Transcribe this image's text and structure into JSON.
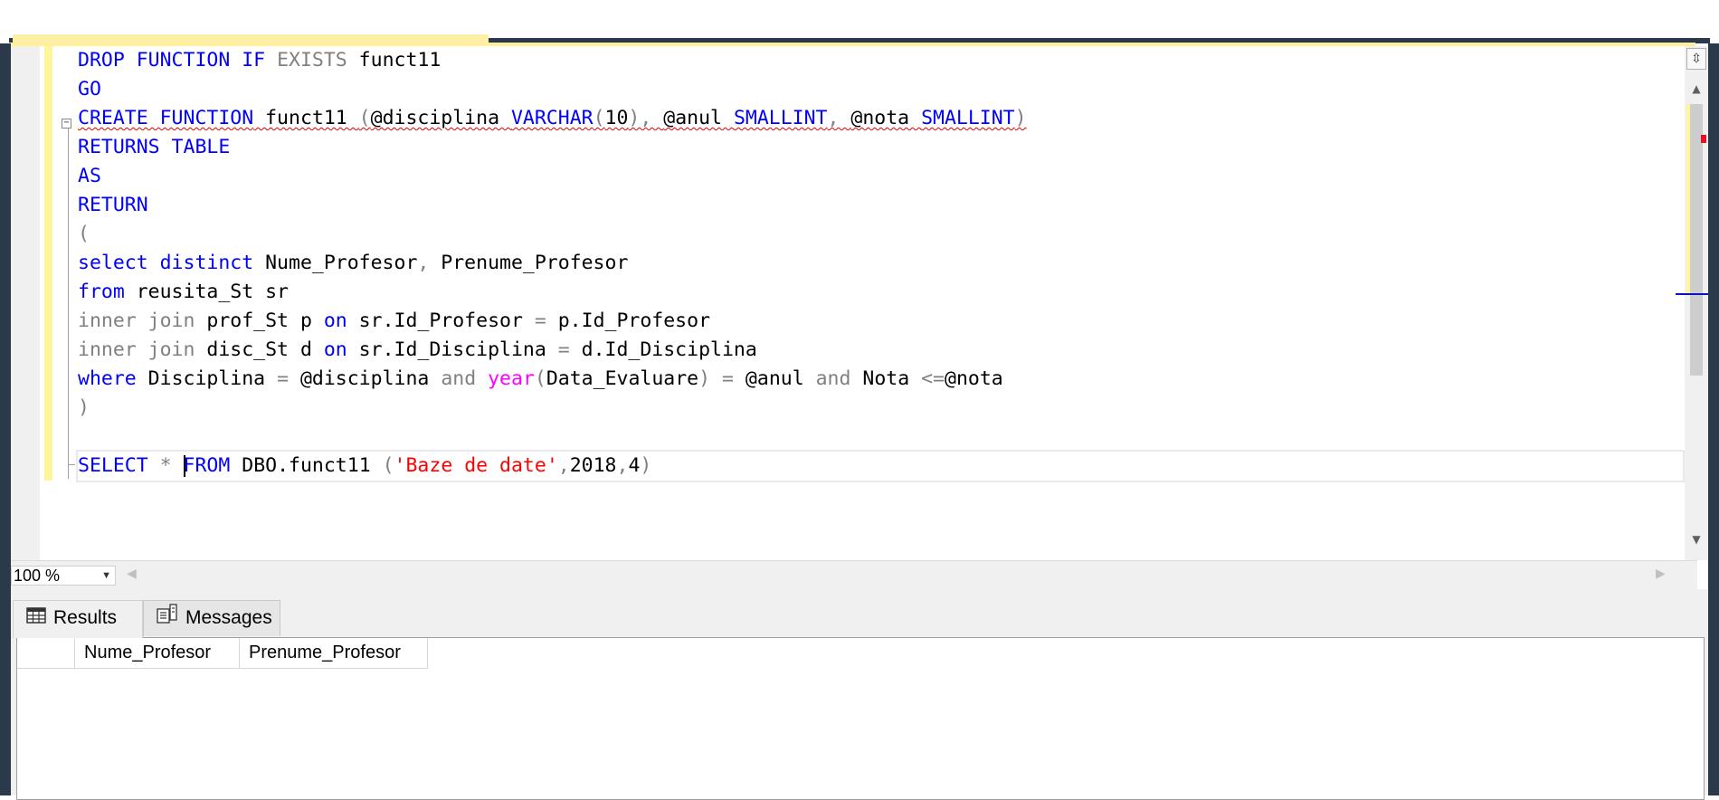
{
  "editor": {
    "lines": [
      [
        {
          "t": "DROP FUNCTION IF ",
          "c": "kw"
        },
        {
          "t": "EXISTS",
          "c": "gr"
        },
        {
          "t": " funct11",
          "c": ""
        }
      ],
      [
        {
          "t": "GO",
          "c": "kw"
        }
      ],
      [
        {
          "t": "CREATE FUNCTION",
          "c": "kw sq"
        },
        {
          "t": " funct11 ",
          "c": "sq"
        },
        {
          "t": "(",
          "c": "gr sq"
        },
        {
          "t": "@disciplina ",
          "c": "sq"
        },
        {
          "t": "VARCHAR",
          "c": "kw sq"
        },
        {
          "t": "(",
          "c": "gr sq"
        },
        {
          "t": "10",
          "c": "sq"
        },
        {
          "t": "), ",
          "c": "gr sq"
        },
        {
          "t": "@anul ",
          "c": "sq"
        },
        {
          "t": "SMALLINT",
          "c": "kw sq"
        },
        {
          "t": ", ",
          "c": "gr sq"
        },
        {
          "t": "@nota ",
          "c": "sq"
        },
        {
          "t": "SMALLINT",
          "c": "kw sq"
        },
        {
          "t": ")",
          "c": "gr sq"
        }
      ],
      [
        {
          "t": "RETURNS TABLE",
          "c": "kw"
        }
      ],
      [
        {
          "t": "AS",
          "c": "kw"
        }
      ],
      [
        {
          "t": "RETURN",
          "c": "kw"
        }
      ],
      [
        {
          "t": "(",
          "c": "gr"
        }
      ],
      [
        {
          "t": "select distinct",
          "c": "kw"
        },
        {
          "t": " Nume_Profesor",
          "c": ""
        },
        {
          "t": ",",
          "c": "gr"
        },
        {
          "t": " Prenume_Profesor",
          "c": ""
        }
      ],
      [
        {
          "t": "from",
          "c": "kw"
        },
        {
          "t": " reusita_St sr",
          "c": ""
        }
      ],
      [
        {
          "t": "inner join",
          "c": "gr"
        },
        {
          "t": " prof_St p ",
          "c": ""
        },
        {
          "t": "on",
          "c": "kw"
        },
        {
          "t": " sr.Id_Profesor ",
          "c": ""
        },
        {
          "t": "=",
          "c": "gr"
        },
        {
          "t": " p.Id_Profesor",
          "c": ""
        }
      ],
      [
        {
          "t": "inner join",
          "c": "gr"
        },
        {
          "t": " disc_St d ",
          "c": ""
        },
        {
          "t": "on",
          "c": "kw"
        },
        {
          "t": " sr.Id_Disciplina ",
          "c": ""
        },
        {
          "t": "=",
          "c": "gr"
        },
        {
          "t": " d.Id_Disciplina",
          "c": ""
        }
      ],
      [
        {
          "t": "where",
          "c": "kw"
        },
        {
          "t": " Disciplina ",
          "c": ""
        },
        {
          "t": "=",
          "c": "gr"
        },
        {
          "t": " @disciplina ",
          "c": ""
        },
        {
          "t": "and",
          "c": "gr"
        },
        {
          "t": " ",
          "c": ""
        },
        {
          "t": "year",
          "c": "fn"
        },
        {
          "t": "(",
          "c": "gr"
        },
        {
          "t": "Data_Evaluare",
          "c": ""
        },
        {
          "t": ")",
          "c": "gr"
        },
        {
          "t": " ",
          "c": ""
        },
        {
          "t": "=",
          "c": "gr"
        },
        {
          "t": " @anul ",
          "c": ""
        },
        {
          "t": "and",
          "c": "gr"
        },
        {
          "t": " Nota ",
          "c": ""
        },
        {
          "t": "<=",
          "c": "gr"
        },
        {
          "t": "@nota",
          "c": ""
        }
      ],
      [
        {
          "t": ")",
          "c": "gr"
        }
      ],
      [],
      [
        {
          "t": "SELECT",
          "c": "kw"
        },
        {
          "t": " ",
          "c": ""
        },
        {
          "t": "*",
          "c": "gr"
        },
        {
          "t": " ",
          "c": ""
        },
        {
          "t": "|",
          "c": "caret"
        },
        {
          "t": "FROM",
          "c": "kw"
        },
        {
          "t": " DBO.funct11 ",
          "c": ""
        },
        {
          "t": "(",
          "c": "gr"
        },
        {
          "t": "'Baze de date'",
          "c": "st"
        },
        {
          "t": ",",
          "c": "gr"
        },
        {
          "t": "2018",
          "c": ""
        },
        {
          "t": ",",
          "c": "gr"
        },
        {
          "t": "4",
          "c": ""
        },
        {
          "t": ")",
          "c": "gr"
        }
      ]
    ],
    "current_line": 14
  },
  "statusbar": {
    "zoom_value": "100 %"
  },
  "results": {
    "tabs": [
      {
        "label": "Results",
        "icon": "grid-icon"
      },
      {
        "label": "Messages",
        "icon": "messages-icon"
      }
    ],
    "columns": [
      "Nume_Profesor",
      "Prenume_Profesor"
    ]
  },
  "colors": {
    "keyword": "#0000ff",
    "operator": "#808080",
    "function": "#ff00ff",
    "string": "#ff0000",
    "change_bar": "#fff59b",
    "frame": "#2b3a4b"
  }
}
